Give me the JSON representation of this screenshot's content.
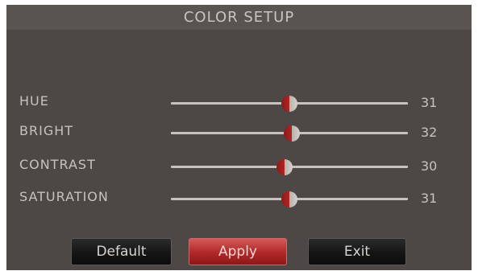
{
  "window": {
    "title": "COLOR SETUP"
  },
  "settings": [
    {
      "label": "HUE",
      "value": "31",
      "level": 0.5
    },
    {
      "label": "BRIGHT",
      "value": "32",
      "level": 0.51
    },
    {
      "label": "CONTRAST",
      "value": "30",
      "level": 0.48
    },
    {
      "label": "SATURATION",
      "value": "31",
      "level": 0.5
    }
  ],
  "buttons": {
    "default_label": "Default",
    "apply_label": "Apply",
    "exit_label": "Exit"
  },
  "colors": {
    "background": "#4d4845",
    "title_bar": "#5a5450",
    "text": "#c6c2be",
    "slider_track": "#c7c2be",
    "slider_thumb_accent": "#b02323",
    "apply_button": "#b52a2a",
    "dark_button": "#151515"
  },
  "icons": {
    "slider_thumb": "half-red-circle-knob"
  }
}
